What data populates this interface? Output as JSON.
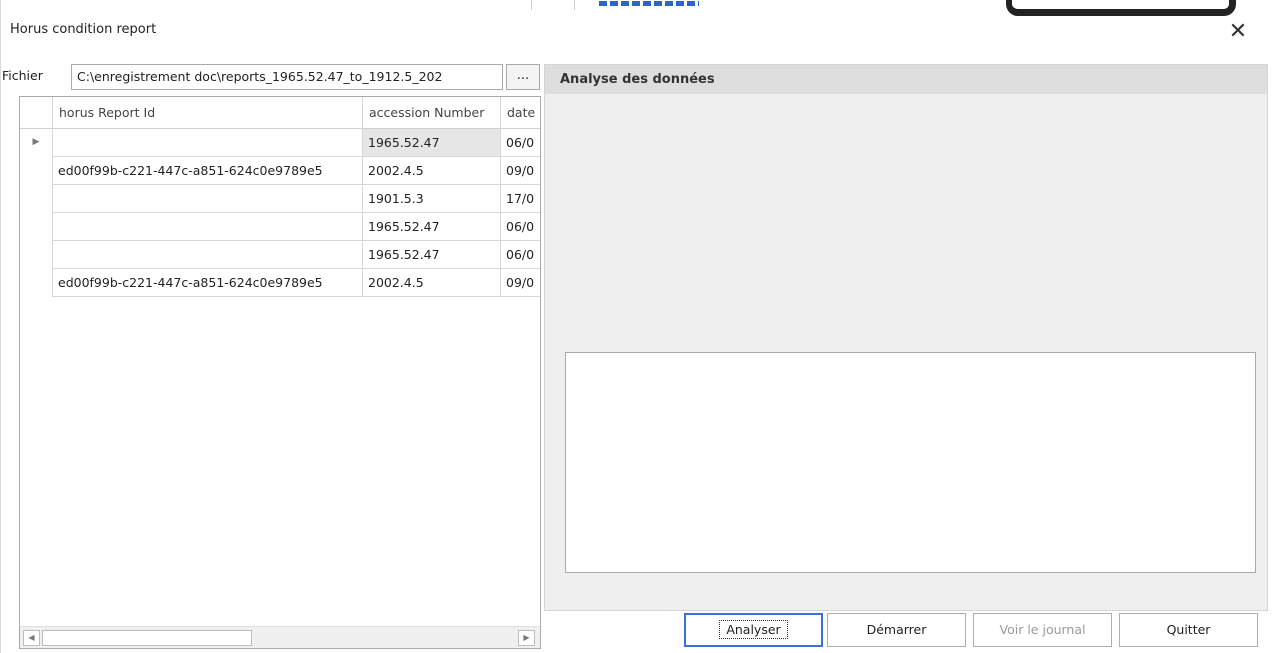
{
  "window": {
    "title": "Horus condition report",
    "close_glyph": "✕"
  },
  "file": {
    "label": "Fichier",
    "path": "C:\\enregistrement doc\\reports_1965.52.47_to_1912.5_202",
    "browse_label": "..."
  },
  "grid": {
    "columns": [
      "horus Report Id",
      "accession Number",
      "date"
    ],
    "rows": [
      {
        "id": "",
        "accession": "1965.52.47",
        "date": "06/0",
        "current": true
      },
      {
        "id": "ed00f99b-c221-447c-a851-624c0e9789e5",
        "accession": "2002.4.5",
        "date": "09/0",
        "current": false
      },
      {
        "id": "",
        "accession": "1901.5.3",
        "date": "17/0",
        "current": false
      },
      {
        "id": "",
        "accession": "1965.52.47",
        "date": "06/0",
        "current": false
      },
      {
        "id": "",
        "accession": "1965.52.47",
        "date": "06/0",
        "current": false
      },
      {
        "id": "ed00f99b-c221-447c-a851-624c0e9789e5",
        "accession": "2002.4.5",
        "date": "09/0",
        "current": false
      }
    ],
    "row_indicator_glyph": "▶",
    "scroll_left_glyph": "◀",
    "scroll_right_glyph": "▶"
  },
  "analysis": {
    "header": "Analyse des données",
    "output_text": ""
  },
  "buttons": {
    "analyze": "Analyser",
    "start": "Démarrer",
    "view_log": "Voir le journal",
    "quit": "Quitter"
  },
  "icons": {
    "close": "close-icon",
    "row_indicator": "row-pointer-icon",
    "scroll_left": "chevron-left-icon",
    "scroll_right": "chevron-right-icon"
  }
}
